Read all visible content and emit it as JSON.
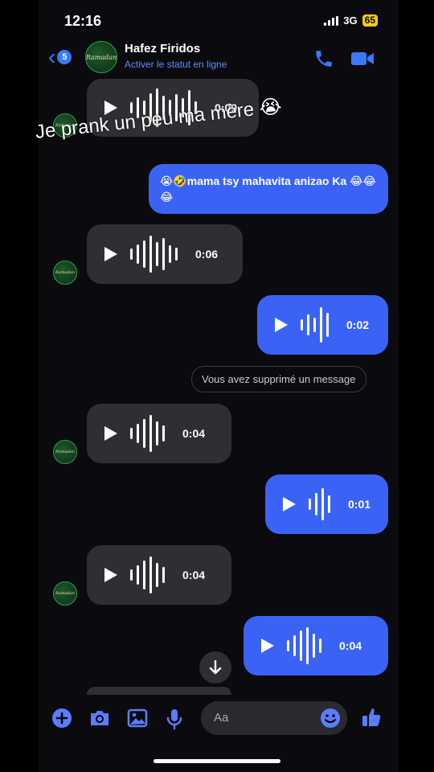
{
  "status": {
    "time": "12:16",
    "network": "3G",
    "battery": "65"
  },
  "header": {
    "back_count": "5",
    "contact_name": "Hafez Firidos",
    "subtitle": "Activer le statut en ligne",
    "avatar_text": "Ramadan"
  },
  "overlay_caption": "Je prank un peu ma mère 😭",
  "messages": [
    {
      "type": "voice",
      "dir": "in",
      "duration": "0:09"
    },
    {
      "type": "text",
      "dir": "out",
      "text": "😭🤣mama tsy mahavita anizao Ka 😂😂😂"
    },
    {
      "type": "voice",
      "dir": "in",
      "duration": "0:06"
    },
    {
      "type": "voice",
      "dir": "out",
      "duration": "0:02"
    },
    {
      "type": "notice",
      "text": "Vous avez supprimé un message"
    },
    {
      "type": "voice",
      "dir": "in",
      "duration": "0:04"
    },
    {
      "type": "voice",
      "dir": "out",
      "duration": "0:01"
    },
    {
      "type": "voice",
      "dir": "in",
      "duration": "0:04"
    },
    {
      "type": "voice",
      "dir": "out",
      "duration": "0:04"
    }
  ],
  "composer": {
    "placeholder": "Aa"
  },
  "colors": {
    "accent": "#3a78ff",
    "outgoing": "#3a63f5",
    "incoming": "#2f2f33",
    "battery": "#f5d000"
  },
  "icons": [
    "back-chevron-icon",
    "phone-icon",
    "video-camera-icon",
    "play-icon",
    "arrow-down-icon",
    "plus-icon",
    "camera-icon",
    "image-icon",
    "microphone-icon",
    "emoji-icon",
    "thumbs-up-icon"
  ]
}
